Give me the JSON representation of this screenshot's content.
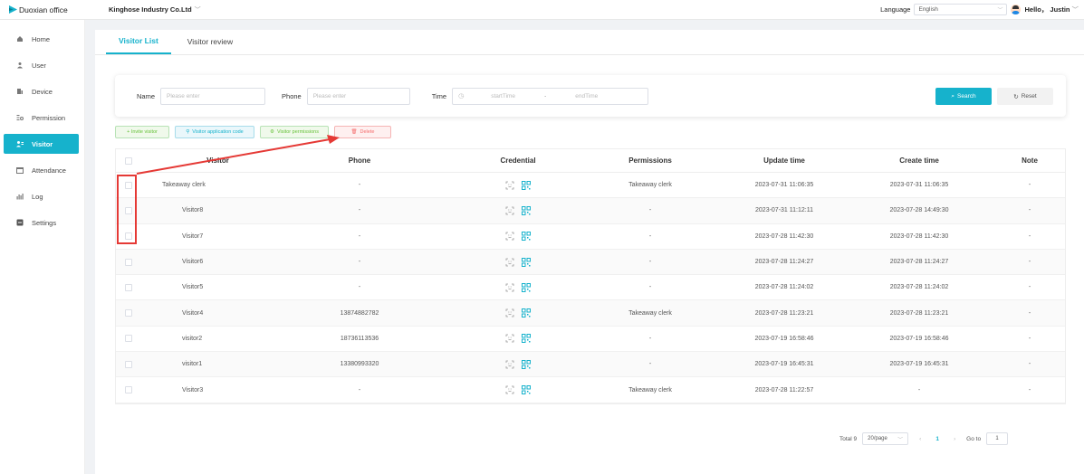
{
  "brand": {
    "name": "Duoxian office"
  },
  "header": {
    "company": "Kinghose Industry Co.Ltd",
    "language_label": "Language",
    "language_value": "English",
    "greeting": "Hello， Justin"
  },
  "sidebar": {
    "items": [
      {
        "label": "Home",
        "icon": "home-icon",
        "active": false
      },
      {
        "label": "User",
        "icon": "user-icon",
        "active": false
      },
      {
        "label": "Device",
        "icon": "device-icon",
        "active": false
      },
      {
        "label": "Permission",
        "icon": "permission-icon",
        "active": false
      },
      {
        "label": "Visitor",
        "icon": "visitor-icon",
        "active": true
      },
      {
        "label": "Attendance",
        "icon": "attendance-icon",
        "active": false
      },
      {
        "label": "Log",
        "icon": "log-icon",
        "active": false
      },
      {
        "label": "Settings",
        "icon": "settings-icon",
        "active": false
      }
    ]
  },
  "tabs": [
    {
      "label": "Visitor List",
      "active": true
    },
    {
      "label": "Visitor review",
      "active": false
    }
  ],
  "filters": {
    "name_label": "Name",
    "name_placeholder": "Please enter",
    "phone_label": "Phone",
    "phone_placeholder": "Please enter",
    "time_label": "Time",
    "start_placeholder": "startTime",
    "separator": "-",
    "end_placeholder": "endTime",
    "search_label": "Search",
    "reset_label": "Reset"
  },
  "actions": {
    "invite": "+ Invite visitor",
    "app_code": "Visitor application code",
    "permissions": "Visitor permissions",
    "delete": "Delete"
  },
  "table": {
    "columns": [
      "Visitor",
      "Phone",
      "Credential",
      "Permissions",
      "Update time",
      "Create time",
      "Note"
    ],
    "rows": [
      {
        "visitor": "Takeaway clerk",
        "phone": "-",
        "permissions": "Takeaway clerk",
        "update": "2023-07-31 11:06:35",
        "create": "2023-07-31 11:06:35",
        "note": "-"
      },
      {
        "visitor": "Visitor8",
        "phone": "-",
        "permissions": "-",
        "update": "2023-07-31 11:12:11",
        "create": "2023-07-28 14:49:30",
        "note": "-"
      },
      {
        "visitor": "Visitor7",
        "phone": "-",
        "permissions": "-",
        "update": "2023-07-28 11:42:30",
        "create": "2023-07-28 11:42:30",
        "note": "-"
      },
      {
        "visitor": "Visitor6",
        "phone": "-",
        "permissions": "-",
        "update": "2023-07-28 11:24:27",
        "create": "2023-07-28 11:24:27",
        "note": "-"
      },
      {
        "visitor": "Visitor5",
        "phone": "-",
        "permissions": "-",
        "update": "2023-07-28 11:24:02",
        "create": "2023-07-28 11:24:02",
        "note": "-"
      },
      {
        "visitor": "Visitor4",
        "phone": "13874882782",
        "permissions": "Takeaway clerk",
        "update": "2023-07-28 11:23:21",
        "create": "2023-07-28 11:23:21",
        "note": "-"
      },
      {
        "visitor": "visitor2",
        "phone": "18736113536",
        "permissions": "-",
        "update": "2023-07-19 16:58:46",
        "create": "2023-07-19 16:58:46",
        "note": "-"
      },
      {
        "visitor": "visitor1",
        "phone": "13380993320",
        "permissions": "-",
        "update": "2023-07-19 16:45:31",
        "create": "2023-07-19 16:45:31",
        "note": "-"
      },
      {
        "visitor": "Visitor3",
        "phone": "-",
        "permissions": "Takeaway clerk",
        "update": "2023-07-28 11:22:57",
        "create": "-",
        "note": "-"
      }
    ]
  },
  "pagination": {
    "total": "Total 9",
    "page_size": "20/page",
    "current_page": "1",
    "goto_label": "Go to",
    "goto_value": "1"
  },
  "colors": {
    "accent": "#16b2cc",
    "annotation": "#e53935"
  }
}
